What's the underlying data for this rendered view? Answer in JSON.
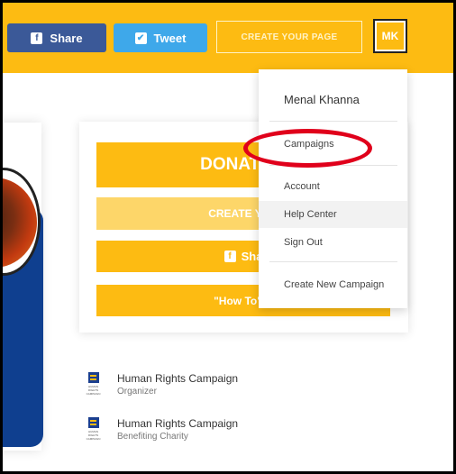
{
  "topbar": {
    "share_label": "Share",
    "tweet_label": "Tweet",
    "create_page_label": "CREATE YOUR PAGE",
    "avatar_initials": "MK",
    "share_icon": "facebook-icon",
    "tweet_icon": "twitter-icon"
  },
  "donate_card": {
    "donate_label": "DONATE T",
    "create_label": "CREATE YOU",
    "share_label": "Sha",
    "howto_label": "\"How To\" C"
  },
  "dropdown": {
    "user_name": "Menal Khanna",
    "items": [
      "Campaigns",
      "Account",
      "Help Center",
      "Sign Out",
      "Create New Campaign"
    ]
  },
  "organizers": [
    {
      "name": "Human Rights Campaign",
      "role": "Organizer",
      "logo_text": "HUMAN RIGHTS CAMPAIGN"
    },
    {
      "name": "Human Rights Campaign",
      "role": "Benefiting Charity",
      "logo_text": "HUMAN RIGHTS CAMPAIGN"
    }
  ],
  "colors": {
    "brand_yellow": "#fdbb12",
    "facebook_blue": "#3b5998",
    "twitter_blue": "#3ea8ea",
    "highlight_red": "#e0001b"
  }
}
